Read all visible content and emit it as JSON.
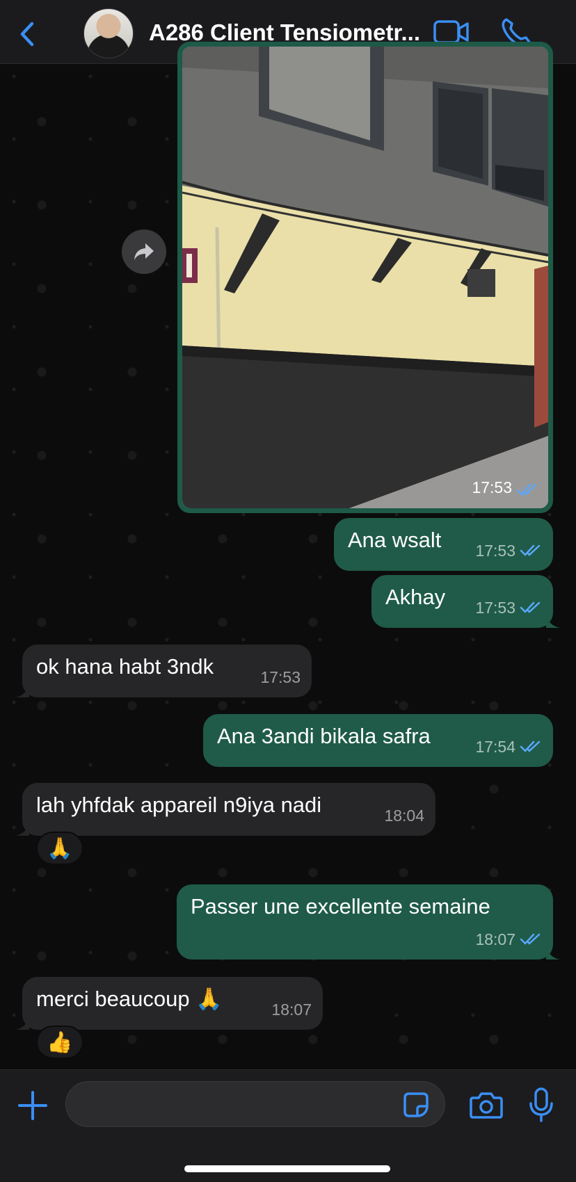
{
  "header": {
    "title": "A286 Client Tensiometr...",
    "back_icon": "chevron-left-icon",
    "video_icon": "video-camera-icon",
    "call_icon": "phone-icon"
  },
  "colors": {
    "accent": "#3a8ff5",
    "outgoing_bubble": "#1f5b48",
    "incoming_bubble": "#262628",
    "read_ticks": "#5aa8ff"
  },
  "messages": [
    {
      "type": "image",
      "direction": "out",
      "time": "17:53",
      "status": "read"
    },
    {
      "type": "text",
      "direction": "out",
      "text": "Ana wsalt",
      "time": "17:53",
      "status": "read"
    },
    {
      "type": "text",
      "direction": "out",
      "text": "Akhay",
      "time": "17:53",
      "status": "read"
    },
    {
      "type": "text",
      "direction": "in",
      "text": "ok hana habt 3ndk",
      "time": "17:53"
    },
    {
      "type": "text",
      "direction": "out",
      "text": "Ana 3andi bikala safra",
      "time": "17:54",
      "status": "read"
    },
    {
      "type": "text",
      "direction": "in",
      "text": "lah yhfdak appareil n9iya nadi",
      "time": "18:04",
      "reaction": "🙏"
    },
    {
      "type": "text",
      "direction": "out",
      "text": "Passer une excellente semaine",
      "time": "18:07",
      "status": "read"
    },
    {
      "type": "text",
      "direction": "in",
      "text": "merci beaucoup 🙏",
      "time": "18:07",
      "reaction": "👍"
    }
  ],
  "input": {
    "placeholder": "",
    "value": "",
    "plus_icon": "plus-icon",
    "sticker_icon": "sticker-icon",
    "camera_icon": "camera-icon",
    "mic_icon": "microphone-icon"
  }
}
